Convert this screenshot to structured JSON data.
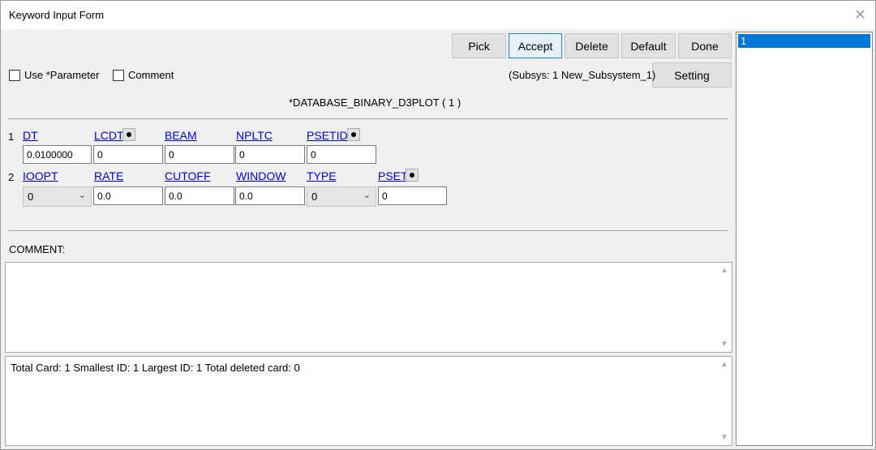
{
  "window": {
    "title": "Keyword Input Form",
    "close_glyph": "✕"
  },
  "toolbar": {
    "pick_label": "Pick",
    "accept_label": "Accept",
    "delete_label": "Delete",
    "default_label": "Default",
    "done_label": "Done",
    "setting_label": "Setting"
  },
  "options": {
    "use_parameter_label": "Use *Parameter",
    "use_parameter_checked": false,
    "comment_label": "Comment",
    "comment_checked": false
  },
  "subsystem_text": "(Subsys: 1 New_Subsystem_1)",
  "keyword_title": "*DATABASE_BINARY_D3PLOT    ( 1 )",
  "card1": {
    "row_num": "1",
    "labels": {
      "dt": "DT",
      "lcdt": "LCDT",
      "beam": "BEAM",
      "npltc": "NPLTC",
      "psetid": "PSETID"
    },
    "values": {
      "dt": "0.0100000",
      "lcdt": "0",
      "beam": "0",
      "npltc": "0",
      "psetid": "0"
    }
  },
  "card2": {
    "row_num": "2",
    "labels": {
      "ioopt": "IOOPT",
      "rate": "RATE",
      "cutoff": "CUTOFF",
      "window": "WINDOW",
      "type": "TYPE",
      "pset": "PSET"
    },
    "values": {
      "ioopt": "0",
      "rate": "0.0",
      "cutoff": "0.0",
      "window": "0.0",
      "type": "0",
      "pset": "0"
    }
  },
  "comment_section_label": "COMMENT:",
  "info_text": "Total Card: 1    Smallest ID: 1   Largest ID: 1   Total deleted card:  0",
  "side_list": {
    "items": [
      "1"
    ],
    "selected_index": 0
  },
  "colors": {
    "selection": "#0078d7",
    "link": "#0000ee",
    "accent_border": "#2c7dd1"
  },
  "icons": {
    "dot": "filled-circle",
    "chevron": "chevron-down",
    "scroll_up": "triangle-up",
    "scroll_down": "triangle-down"
  }
}
